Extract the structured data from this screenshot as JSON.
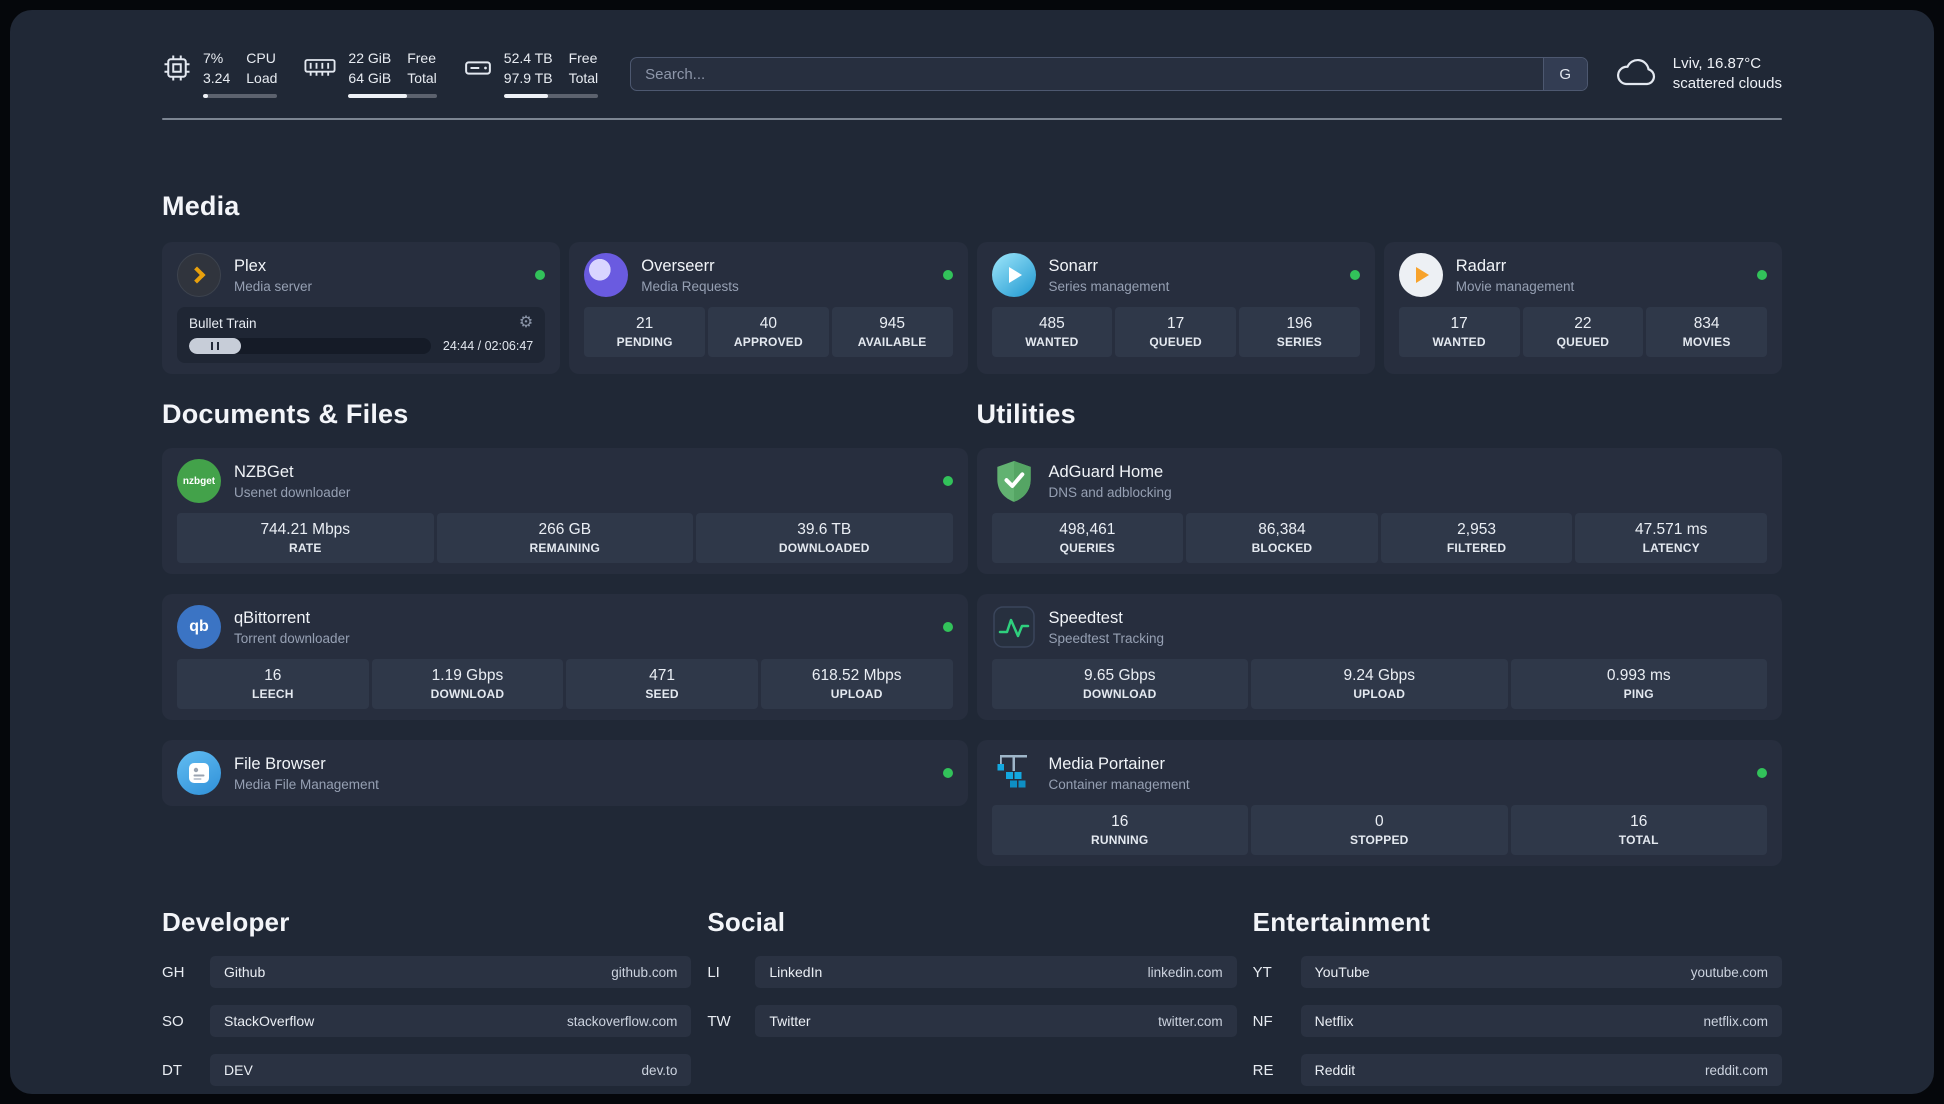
{
  "colors": {
    "background": "#202836",
    "card": "#272e3e",
    "tile": "#2f3849",
    "status_green": "#32c25a",
    "plex_accent": "#e8a00c"
  },
  "topbar": {
    "cpu": {
      "percent": "7%",
      "load": "3.24",
      "labels": {
        "top": "CPU",
        "bottom": "Load"
      }
    },
    "ram": {
      "free": "22 GiB",
      "total": "64 GiB",
      "labels": {
        "top": "Free",
        "bottom": "Total"
      }
    },
    "disk": {
      "free": "52.4 TB",
      "total": "97.9 TB",
      "labels": {
        "top": "Free",
        "bottom": "Total"
      }
    },
    "search": {
      "placeholder": "Search...",
      "engine_button": "G"
    },
    "weather": {
      "location": "Lviv, 16.87°C",
      "condition": "scattered clouds"
    }
  },
  "media": {
    "heading": "Media",
    "plex": {
      "title": "Plex",
      "subtitle": "Media server",
      "now_playing": "Bullet Train",
      "time": "24:44 / 02:06:47"
    },
    "overseerr": {
      "title": "Overseerr",
      "subtitle": "Media Requests",
      "stats": [
        {
          "value": "21",
          "label": "PENDING"
        },
        {
          "value": "40",
          "label": "APPROVED"
        },
        {
          "value": "945",
          "label": "AVAILABLE"
        }
      ]
    },
    "sonarr": {
      "title": "Sonarr",
      "subtitle": "Series management",
      "stats": [
        {
          "value": "485",
          "label": "WANTED"
        },
        {
          "value": "17",
          "label": "QUEUED"
        },
        {
          "value": "196",
          "label": "SERIES"
        }
      ]
    },
    "radarr": {
      "title": "Radarr",
      "subtitle": "Movie management",
      "stats": [
        {
          "value": "17",
          "label": "WANTED"
        },
        {
          "value": "22",
          "label": "QUEUED"
        },
        {
          "value": "834",
          "label": "MOVIES"
        }
      ]
    }
  },
  "documents": {
    "heading": "Documents & Files",
    "nzbget": {
      "title": "NZBGet",
      "subtitle": "Usenet downloader",
      "icon_text": "nzbget",
      "stats": [
        {
          "value": "744.21 Mbps",
          "label": "RATE"
        },
        {
          "value": "266 GB",
          "label": "REMAINING"
        },
        {
          "value": "39.6 TB",
          "label": "DOWNLOADED"
        }
      ]
    },
    "qbittorrent": {
      "title": "qBittorrent",
      "subtitle": "Torrent downloader",
      "icon_text": "qb",
      "stats": [
        {
          "value": "16",
          "label": "LEECH"
        },
        {
          "value": "1.19 Gbps",
          "label": "DOWNLOAD"
        },
        {
          "value": "471",
          "label": "SEED"
        },
        {
          "value": "618.52 Mbps",
          "label": "UPLOAD"
        }
      ]
    },
    "filebrowser": {
      "title": "File Browser",
      "subtitle": "Media File Management"
    }
  },
  "utilities": {
    "heading": "Utilities",
    "adguard": {
      "title": "AdGuard Home",
      "subtitle": "DNS and adblocking",
      "stats": [
        {
          "value": "498,461",
          "label": "QUERIES"
        },
        {
          "value": "86,384",
          "label": "BLOCKED"
        },
        {
          "value": "2,953",
          "label": "FILTERED"
        },
        {
          "value": "47.571 ms",
          "label": "LATENCY"
        }
      ]
    },
    "speedtest": {
      "title": "Speedtest",
      "subtitle": "Speedtest Tracking",
      "stats": [
        {
          "value": "9.65 Gbps",
          "label": "DOWNLOAD"
        },
        {
          "value": "9.24 Gbps",
          "label": "UPLOAD"
        },
        {
          "value": "0.993 ms",
          "label": "PING"
        }
      ]
    },
    "portainer": {
      "title": "Media Portainer",
      "subtitle": "Container management",
      "stats": [
        {
          "value": "16",
          "label": "RUNNING"
        },
        {
          "value": "0",
          "label": "STOPPED"
        },
        {
          "value": "16",
          "label": "TOTAL"
        }
      ]
    }
  },
  "links": {
    "developer": {
      "heading": "Developer",
      "items": [
        {
          "abbr": "GH",
          "name": "Github",
          "url": "github.com"
        },
        {
          "abbr": "SO",
          "name": "StackOverflow",
          "url": "stackoverflow.com"
        },
        {
          "abbr": "DT",
          "name": "DEV",
          "url": "dev.to"
        }
      ]
    },
    "social": {
      "heading": "Social",
      "items": [
        {
          "abbr": "LI",
          "name": "LinkedIn",
          "url": "linkedin.com"
        },
        {
          "abbr": "TW",
          "name": "Twitter",
          "url": "twitter.com"
        }
      ]
    },
    "entertainment": {
      "heading": "Entertainment",
      "items": [
        {
          "abbr": "YT",
          "name": "YouTube",
          "url": "youtube.com"
        },
        {
          "abbr": "NF",
          "name": "Netflix",
          "url": "netflix.com"
        },
        {
          "abbr": "RE",
          "name": "Reddit",
          "url": "reddit.com"
        }
      ]
    }
  }
}
